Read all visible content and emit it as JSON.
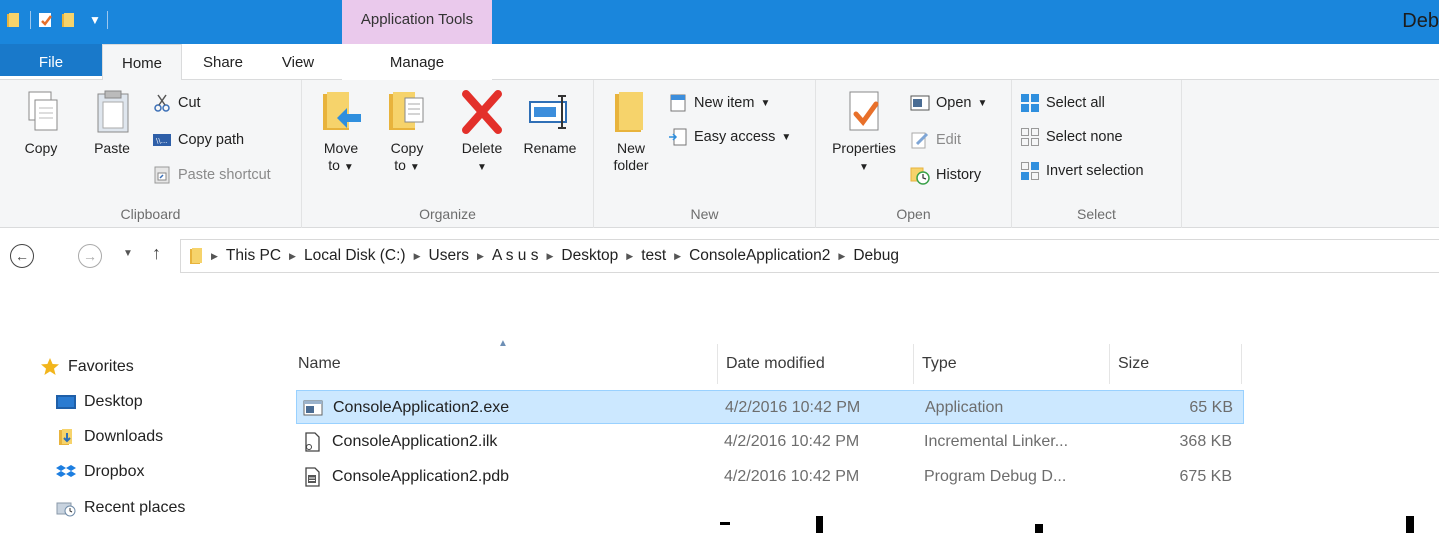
{
  "window": {
    "title": "Deb",
    "context_tab": "Application Tools"
  },
  "tabs": {
    "file": "File",
    "home": "Home",
    "share": "Share",
    "view": "View",
    "manage": "Manage"
  },
  "ribbon": {
    "clipboard": {
      "label": "Clipboard",
      "copy": "Copy",
      "paste": "Paste",
      "cut": "Cut",
      "copy_path": "Copy path",
      "paste_shortcut": "Paste shortcut"
    },
    "organize": {
      "label": "Organize",
      "move_to_line1": "Move",
      "move_to_line2": "to",
      "copy_to_line1": "Copy",
      "copy_to_line2": "to",
      "delete": "Delete",
      "rename": "Rename"
    },
    "new": {
      "label": "New",
      "new_folder_line1": "New",
      "new_folder_line2": "folder",
      "new_item": "New item",
      "easy_access": "Easy access"
    },
    "open": {
      "label": "Open",
      "properties": "Properties",
      "open": "Open",
      "edit": "Edit",
      "history": "History"
    },
    "select": {
      "label": "Select",
      "select_all": "Select all",
      "select_none": "Select none",
      "invert_selection": "Invert selection"
    }
  },
  "address": {
    "crumbs": [
      "This PC",
      "Local Disk (C:)",
      "Users",
      "A s u s",
      "Desktop",
      "test",
      "ConsoleApplication2",
      "Debug"
    ]
  },
  "navpane": {
    "items": [
      {
        "label": "Favorites",
        "icon": "star-icon"
      },
      {
        "label": "Desktop",
        "icon": "desktop-icon"
      },
      {
        "label": "Downloads",
        "icon": "downloads-icon"
      },
      {
        "label": "Dropbox",
        "icon": "dropbox-icon"
      },
      {
        "label": "Recent places",
        "icon": "recent-places-icon"
      }
    ]
  },
  "filelist": {
    "columns": {
      "name": "Name",
      "date": "Date modified",
      "type": "Type",
      "size": "Size"
    },
    "rows": [
      {
        "name": "ConsoleApplication2.exe",
        "date": "4/2/2016 10:42 PM",
        "type": "Application",
        "size": "65 KB",
        "icon": "exe-file-icon",
        "selected": true
      },
      {
        "name": "ConsoleApplication2.ilk",
        "date": "4/2/2016 10:42 PM",
        "type": "Incremental Linker...",
        "size": "368 KB",
        "icon": "ilk-file-icon",
        "selected": false
      },
      {
        "name": "ConsoleApplication2.pdb",
        "date": "4/2/2016 10:42 PM",
        "type": "Program Debug D...",
        "size": "675 KB",
        "icon": "pdb-file-icon",
        "selected": false
      }
    ]
  },
  "colors": {
    "titlebar": "#1a86dc",
    "file_tab": "#1979ca",
    "context_tab": "#eac9ec",
    "selection": "#cce8ff",
    "ribbon_bg": "#f5f6f7"
  }
}
